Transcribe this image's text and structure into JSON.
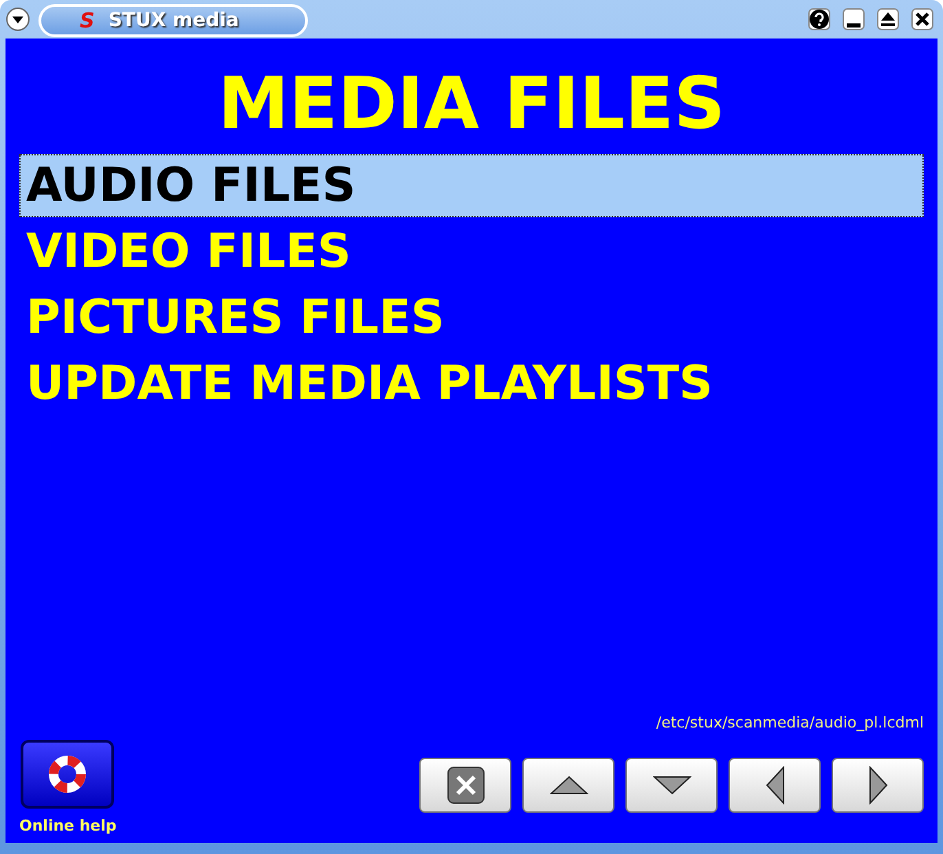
{
  "window": {
    "logo": "S",
    "title": "STUX media"
  },
  "heading": "MEDIA FILES",
  "menu": [
    {
      "label": "AUDIO FILES",
      "selected": true
    },
    {
      "label": "VIDEO FILES",
      "selected": false
    },
    {
      "label": "PICTURES FILES",
      "selected": false
    },
    {
      "label": "UPDATE MEDIA PLAYLISTS",
      "selected": false
    }
  ],
  "file_path": "/etc/stux/scanmedia/audio_pl.lcdml",
  "help": {
    "label": "Online help"
  },
  "nav_buttons": [
    {
      "kind": "close"
    },
    {
      "kind": "up"
    },
    {
      "kind": "down"
    },
    {
      "kind": "left"
    },
    {
      "kind": "right"
    }
  ]
}
